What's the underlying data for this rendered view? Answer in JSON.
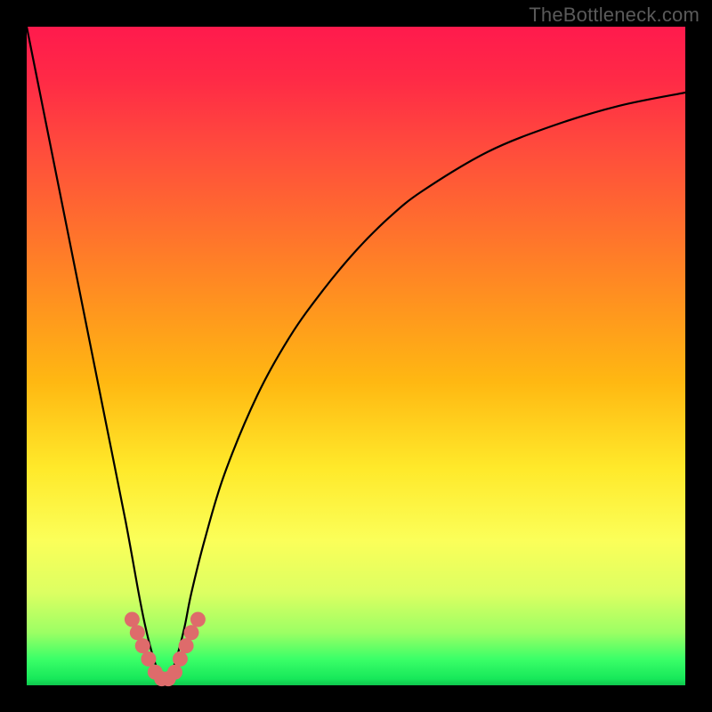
{
  "watermark": "TheBottleneck.com",
  "chart_data": {
    "type": "line",
    "title": "",
    "xlabel": "",
    "ylabel": "",
    "xlim": [
      0,
      100
    ],
    "ylim": [
      0,
      100
    ],
    "series": [
      {
        "name": "bottleneck-curve",
        "x": [
          0,
          3,
          6,
          9,
          12,
          15,
          17,
          18,
          19,
          20,
          21,
          22,
          23,
          24,
          25,
          27,
          30,
          35,
          40,
          45,
          50,
          55,
          60,
          70,
          80,
          90,
          100
        ],
        "values": [
          100,
          85,
          70,
          55,
          40,
          25,
          14,
          9,
          5,
          2,
          0,
          2,
          5,
          9,
          14,
          22,
          32,
          44,
          53,
          60,
          66,
          71,
          75,
          81,
          85,
          88,
          90
        ]
      }
    ],
    "markers": {
      "name": "highlight-dots",
      "color": "#de6b6b",
      "x": [
        16.0,
        16.8,
        17.6,
        18.5,
        19.5,
        20.5,
        21.5,
        22.5,
        23.3,
        24.2,
        25.0,
        26.0
      ],
      "values": [
        10.0,
        8.0,
        6.0,
        4.0,
        2.0,
        1.0,
        1.0,
        2.0,
        4.0,
        6.0,
        8.0,
        10.0
      ]
    }
  }
}
